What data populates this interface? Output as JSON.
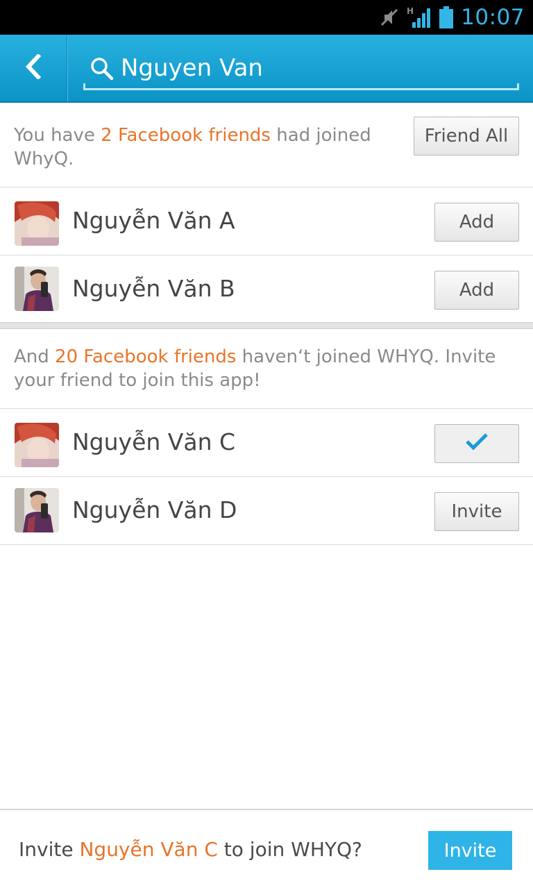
{
  "status_bar": {
    "time": "10:07",
    "icons": [
      "mute-icon",
      "network-h-icon",
      "signal-icon",
      "battery-icon"
    ]
  },
  "action_bar": {
    "back_icon": "chevron-left-icon",
    "search_icon": "search-icon",
    "search_query": "Nguyen Van"
  },
  "joined_section": {
    "prefix": "You have ",
    "highlight": "2 Facebook friends",
    "suffix": " had joined WhyQ.",
    "friend_all_label": "Friend All",
    "friends": [
      {
        "name": "Nguyễn Văn A",
        "button": "Add"
      },
      {
        "name": "Nguyễn Văn B",
        "button": "Add"
      }
    ]
  },
  "invite_section": {
    "prefix": "And ",
    "highlight": "20 Facebook friends",
    "suffix": " haven‘t joined WHYQ. Invite your friend to join this app!",
    "friends": [
      {
        "name": "Nguyễn Văn C",
        "button": "",
        "state": "checked"
      },
      {
        "name": "Nguyễn Văn D",
        "button": "Invite"
      }
    ]
  },
  "bottom_bar": {
    "prefix": "Invite ",
    "highlight": "Nguyễn Văn C",
    "suffix": " to join WHYQ?",
    "invite_label": "Invite"
  },
  "colors": {
    "accent": "#2eb4e6",
    "highlight": "#e8742a",
    "action_bar": "#0b93c5"
  }
}
